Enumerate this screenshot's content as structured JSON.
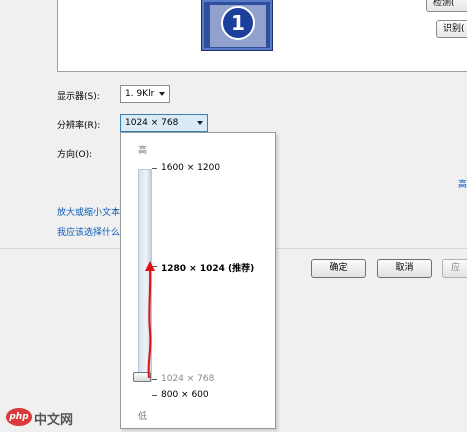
{
  "side_buttons": {
    "detect": "检测(",
    "identify": "识别("
  },
  "monitor": {
    "number": "1"
  },
  "form": {
    "display_label": "显示器(S):",
    "display_value": "1. 9Klr",
    "resolution_label": "分辨率(R):",
    "resolution_value": "1024 × 768",
    "orientation_label": "方向(O):"
  },
  "links": {
    "advanced": "高",
    "enlarge_text": "放大或缩小文本",
    "which_to_choose": "我应该选择什么"
  },
  "dropdown": {
    "high_label": "高",
    "low_label": "低",
    "options": [
      {
        "label": "1600 × 1200",
        "bold": false,
        "muted": false
      },
      {
        "label": "1280 × 1024 (推荐)",
        "bold": true,
        "muted": false
      },
      {
        "label": "1024 × 768",
        "bold": false,
        "muted": true
      },
      {
        "label": "800 × 600",
        "bold": false,
        "muted": false
      }
    ],
    "selected": "1024 × 768",
    "annotation_color": "#e01010"
  },
  "buttons": {
    "ok": "确定",
    "cancel": "取消",
    "apply": "应"
  },
  "watermark": {
    "logo": "php",
    "text": "中文网"
  }
}
